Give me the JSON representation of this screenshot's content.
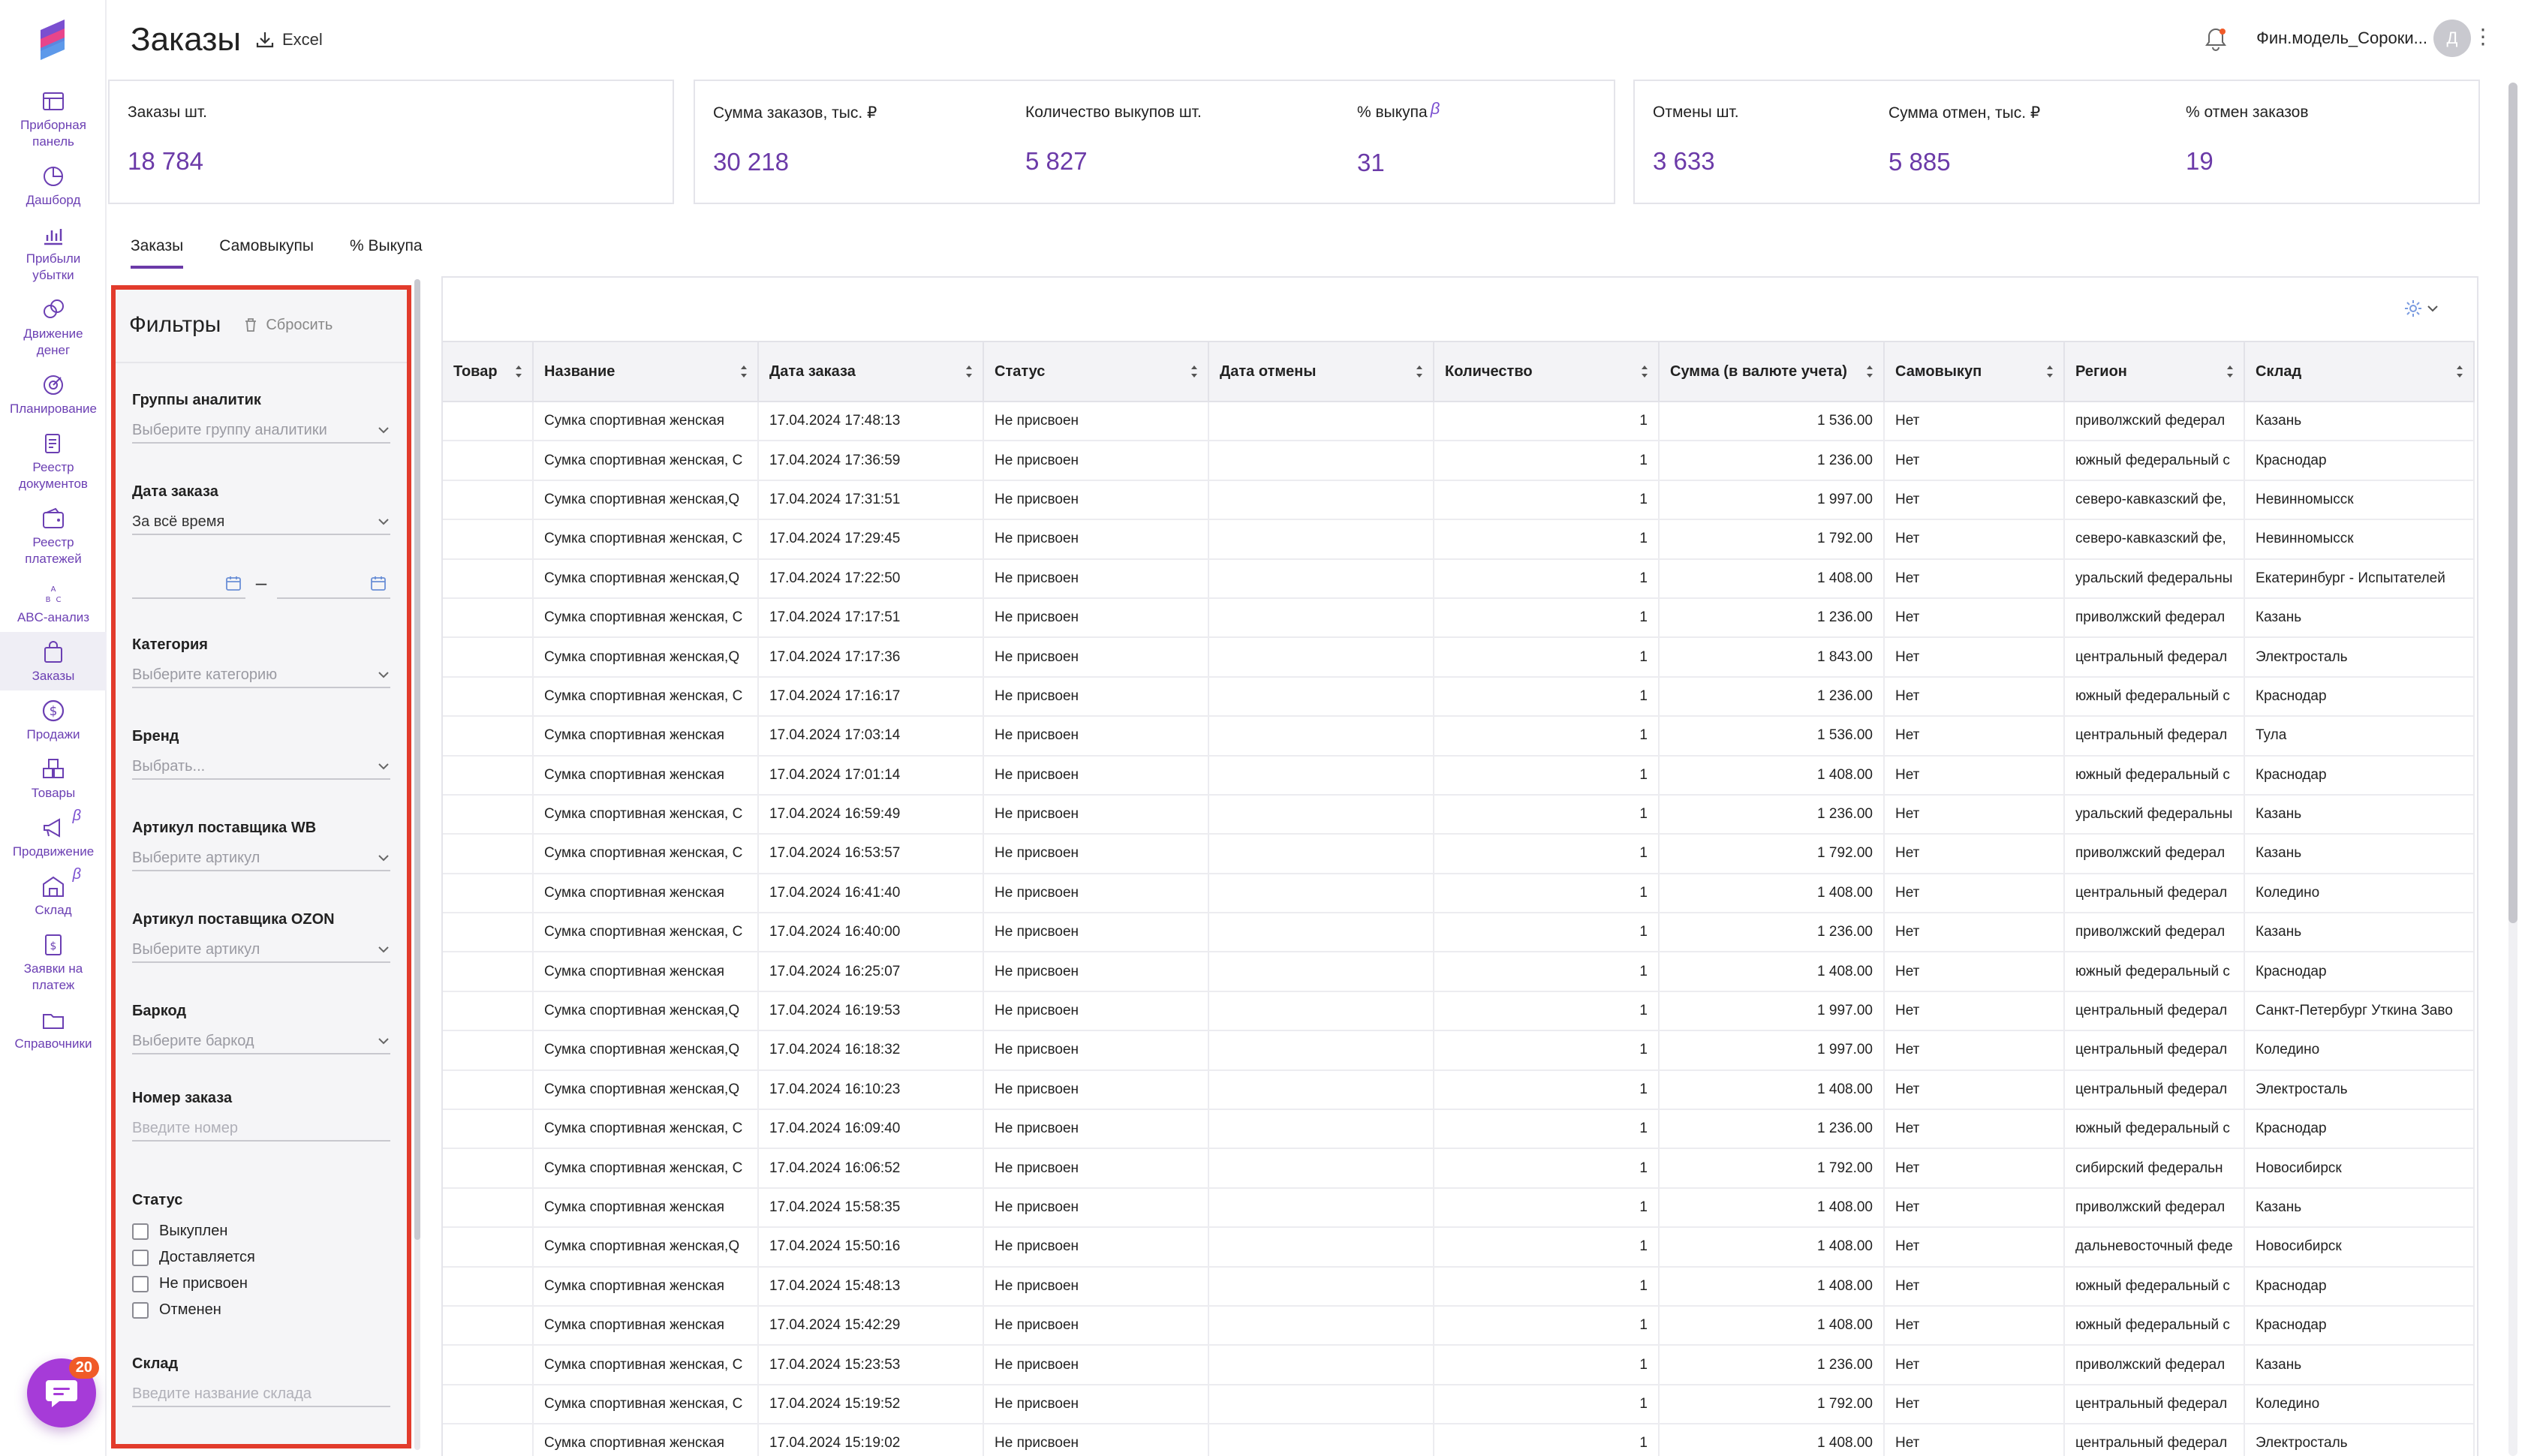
{
  "brand_colors": {
    "accent": "#6b3aa8",
    "highlight_border": "#e23b2c",
    "chat_button": "#a63bd8"
  },
  "sidebar": {
    "items": [
      {
        "label": "Приборная\nпанель",
        "icon": "dashboard-grid-icon"
      },
      {
        "label": "Дашборд",
        "icon": "pie-chart-icon"
      },
      {
        "label": "Прибыли\nубытки",
        "icon": "bar-chart-icon"
      },
      {
        "label": "Движение\nденег",
        "icon": "coins-icon"
      },
      {
        "label": "Планирование",
        "icon": "target-icon"
      },
      {
        "label": "Реестр\nдокументов",
        "icon": "documents-icon"
      },
      {
        "label": "Реестр\nплатежей",
        "icon": "wallet-icon"
      },
      {
        "label": "ABC-анализ",
        "icon": "abc-icon"
      },
      {
        "label": "Заказы",
        "icon": "shopping-bag-icon"
      },
      {
        "label": "Продажи",
        "icon": "dollar-circle-icon"
      },
      {
        "label": "Товары",
        "icon": "boxes-icon"
      },
      {
        "label": "Продвижение",
        "icon": "megaphone-icon",
        "beta": "β"
      },
      {
        "label": "Склад",
        "icon": "warehouse-icon",
        "beta": "β"
      },
      {
        "label": "Заявки на\nплатеж",
        "icon": "payment-request-icon"
      },
      {
        "label": "Справочники",
        "icon": "folder-icon"
      }
    ],
    "active_index": 8,
    "chat_badge": "20"
  },
  "header": {
    "title": "Заказы",
    "excel_label": "Excel",
    "user_name": "Фин.модель_Сороки...",
    "avatar_initial": "Д"
  },
  "kpis": {
    "orders_count": {
      "label": "Заказы шт.",
      "value": "18 784"
    },
    "orders_sum": {
      "label": "Сумма заказов, тыс. ₽",
      "value": "30 218"
    },
    "buyouts_count": {
      "label": "Количество выкупов шт.",
      "value": "5 827"
    },
    "buyout_percent": {
      "label": "% выкупа",
      "beta": "β",
      "value": "31"
    },
    "cancels_count": {
      "label": "Отмены шт.",
      "value": "3 633"
    },
    "cancels_sum": {
      "label": "Сумма отмен, тыс. ₽",
      "value": "5 885"
    },
    "cancels_percent": {
      "label": "% отмен заказов",
      "value": "19"
    }
  },
  "tabs": [
    "Заказы",
    "Самовыкупы",
    "% Выкупа"
  ],
  "active_tab": 0,
  "filters": {
    "title": "Фильтры",
    "reset_label": "Сбросить",
    "analytics_groups": {
      "label": "Группы аналитик",
      "placeholder": "Выберите группу аналитики"
    },
    "order_date": {
      "label": "Дата заказа",
      "value": "За всё время",
      "range_dash": "–"
    },
    "category": {
      "label": "Категория",
      "placeholder": "Выберите категорию"
    },
    "brand": {
      "label": "Бренд",
      "placeholder": "Выбрать..."
    },
    "wb_article": {
      "label": "Артикул поставщика WB",
      "placeholder": "Выберите артикул"
    },
    "ozon_article": {
      "label": "Артикул поставщика OZON",
      "placeholder": "Выберите артикул"
    },
    "barcode": {
      "label": "Баркод",
      "placeholder": "Выберите баркод"
    },
    "order_number": {
      "label": "Номер заказа",
      "placeholder": "Введите номер"
    },
    "status": {
      "label": "Статус",
      "options": [
        "Выкуплен",
        "Доставляется",
        "Не присвоен",
        "Отменен"
      ]
    },
    "warehouse": {
      "label": "Склад",
      "placeholder": "Введите название склада"
    }
  },
  "table": {
    "columns": [
      "Товар",
      "Название",
      "Дата заказа",
      "Статус",
      "Дата отмены",
      "Количество",
      "Сумма (в валюте учета)",
      "Самовыкуп",
      "Регион",
      "Склад"
    ],
    "rows": [
      [
        "",
        "Сумка спортивная женская",
        "17.04.2024 17:48:13",
        "Не присвоен",
        "",
        "1",
        "1 536.00",
        "Нет",
        "приволжский федерал",
        "Казань"
      ],
      [
        "",
        "Сумка спортивная женская, С",
        "17.04.2024 17:36:59",
        "Не присвоен",
        "",
        "1",
        "1 236.00",
        "Нет",
        "южный федеральный с",
        "Краснодар"
      ],
      [
        "",
        "Сумка спортивная женская,Q",
        "17.04.2024 17:31:51",
        "Не присвоен",
        "",
        "1",
        "1 997.00",
        "Нет",
        "северо-кавказский фе,",
        "Невинномысск"
      ],
      [
        "",
        "Сумка спортивная женская, С",
        "17.04.2024 17:29:45",
        "Не присвоен",
        "",
        "1",
        "1 792.00",
        "Нет",
        "северо-кавказский фе,",
        "Невинномысск"
      ],
      [
        "",
        "Сумка спортивная женская,Q",
        "17.04.2024 17:22:50",
        "Не присвоен",
        "",
        "1",
        "1 408.00",
        "Нет",
        "уральский федеральны",
        "Екатеринбург - Испытателей"
      ],
      [
        "",
        "Сумка спортивная женская, С",
        "17.04.2024 17:17:51",
        "Не присвоен",
        "",
        "1",
        "1 236.00",
        "Нет",
        "приволжский федерал",
        "Казань"
      ],
      [
        "",
        "Сумка спортивная женская,Q",
        "17.04.2024 17:17:36",
        "Не присвоен",
        "",
        "1",
        "1 843.00",
        "Нет",
        "центральный федерал",
        "Электросталь"
      ],
      [
        "",
        "Сумка спортивная женская, С",
        "17.04.2024 17:16:17",
        "Не присвоен",
        "",
        "1",
        "1 236.00",
        "Нет",
        "южный федеральный с",
        "Краснодар"
      ],
      [
        "",
        "Сумка спортивная женская",
        "17.04.2024 17:03:14",
        "Не присвоен",
        "",
        "1",
        "1 536.00",
        "Нет",
        "центральный федерал",
        "Тула"
      ],
      [
        "",
        "Сумка спортивная женская",
        "17.04.2024 17:01:14",
        "Не присвоен",
        "",
        "1",
        "1 408.00",
        "Нет",
        "южный федеральный с",
        "Краснодар"
      ],
      [
        "",
        "Сумка спортивная женская, С",
        "17.04.2024 16:59:49",
        "Не присвоен",
        "",
        "1",
        "1 236.00",
        "Нет",
        "уральский федеральны",
        "Казань"
      ],
      [
        "",
        "Сумка спортивная женская, С",
        "17.04.2024 16:53:57",
        "Не присвоен",
        "",
        "1",
        "1 792.00",
        "Нет",
        "приволжский федерал",
        "Казань"
      ],
      [
        "",
        "Сумка спортивная женская",
        "17.04.2024 16:41:40",
        "Не присвоен",
        "",
        "1",
        "1 408.00",
        "Нет",
        "центральный федерал",
        "Коледино"
      ],
      [
        "",
        "Сумка спортивная женская, С",
        "17.04.2024 16:40:00",
        "Не присвоен",
        "",
        "1",
        "1 236.00",
        "Нет",
        "приволжский федерал",
        "Казань"
      ],
      [
        "",
        "Сумка спортивная женская",
        "17.04.2024 16:25:07",
        "Не присвоен",
        "",
        "1",
        "1 408.00",
        "Нет",
        "южный федеральный с",
        "Краснодар"
      ],
      [
        "",
        "Сумка спортивная женская,Q",
        "17.04.2024 16:19:53",
        "Не присвоен",
        "",
        "1",
        "1 997.00",
        "Нет",
        "центральный федерал",
        "Санкт-Петербург Уткина Заво"
      ],
      [
        "",
        "Сумка спортивная женская,Q",
        "17.04.2024 16:18:32",
        "Не присвоен",
        "",
        "1",
        "1 997.00",
        "Нет",
        "центральный федерал",
        "Коледино"
      ],
      [
        "",
        "Сумка спортивная женская,Q",
        "17.04.2024 16:10:23",
        "Не присвоен",
        "",
        "1",
        "1 408.00",
        "Нет",
        "центральный федерал",
        "Электросталь"
      ],
      [
        "",
        "Сумка спортивная женская, С",
        "17.04.2024 16:09:40",
        "Не присвоен",
        "",
        "1",
        "1 236.00",
        "Нет",
        "южный федеральный с",
        "Краснодар"
      ],
      [
        "",
        "Сумка спортивная женская, С",
        "17.04.2024 16:06:52",
        "Не присвоен",
        "",
        "1",
        "1 792.00",
        "Нет",
        "сибирский федеральн",
        "Новосибирск"
      ],
      [
        "",
        "Сумка спортивная женская",
        "17.04.2024 15:58:35",
        "Не присвоен",
        "",
        "1",
        "1 408.00",
        "Нет",
        "приволжский федерал",
        "Казань"
      ],
      [
        "",
        "Сумка спортивная женская,Q",
        "17.04.2024 15:50:16",
        "Не присвоен",
        "",
        "1",
        "1 408.00",
        "Нет",
        "дальневосточный феде",
        "Новосибирск"
      ],
      [
        "",
        "Сумка спортивная женская",
        "17.04.2024 15:48:13",
        "Не присвоен",
        "",
        "1",
        "1 408.00",
        "Нет",
        "южный федеральный с",
        "Краснодар"
      ],
      [
        "",
        "Сумка спортивная женская",
        "17.04.2024 15:42:29",
        "Не присвоен",
        "",
        "1",
        "1 408.00",
        "Нет",
        "южный федеральный с",
        "Краснодар"
      ],
      [
        "",
        "Сумка спортивная женская, С",
        "17.04.2024 15:23:53",
        "Не присвоен",
        "",
        "1",
        "1 236.00",
        "Нет",
        "приволжский федерал",
        "Казань"
      ],
      [
        "",
        "Сумка спортивная женская, С",
        "17.04.2024 15:19:52",
        "Не присвоен",
        "",
        "1",
        "1 792.00",
        "Нет",
        "центральный федерал",
        "Коледино"
      ],
      [
        "",
        "Сумка спортивная женская",
        "17.04.2024 15:19:02",
        "Не присвоен",
        "",
        "1",
        "1 408.00",
        "Нет",
        "центральный федерал",
        "Электросталь"
      ]
    ]
  }
}
